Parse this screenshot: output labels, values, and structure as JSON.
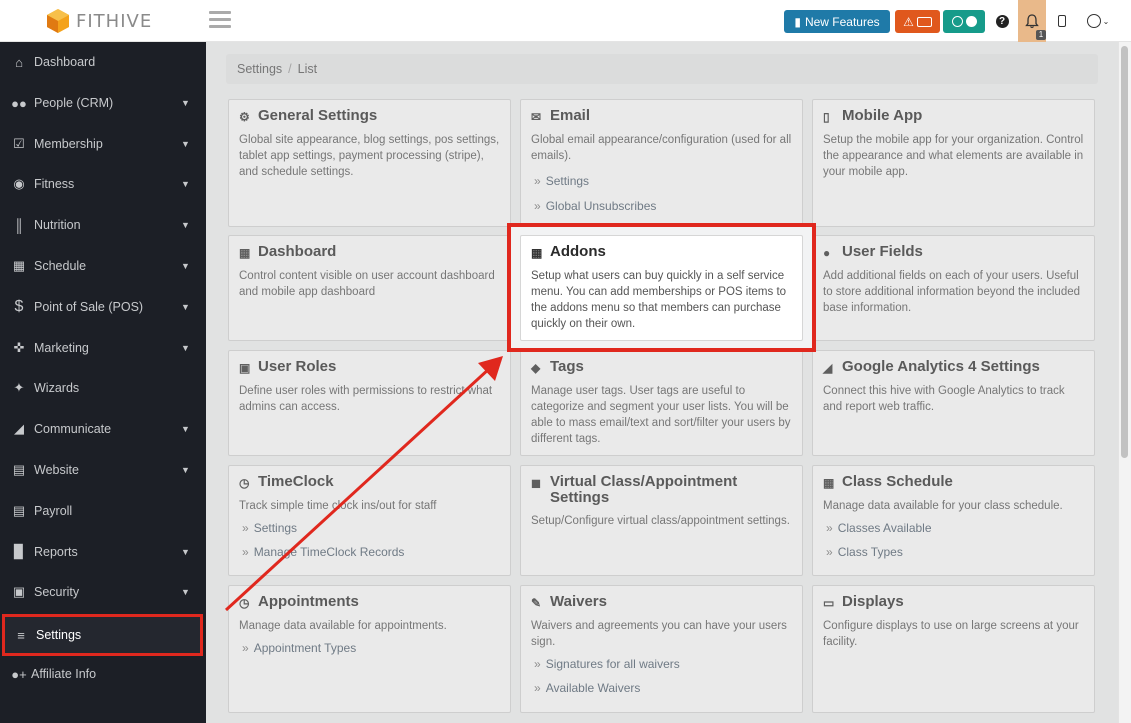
{
  "app": {
    "name": "FITHIVE"
  },
  "topbar": {
    "new_features_label": "New Features",
    "notification_count": "1",
    "colors": {
      "features": "#1f7aa8",
      "alert": "#e0581d",
      "clock": "#169b8a",
      "bell_bg": "#e9b98a"
    }
  },
  "sidebar": {
    "items": [
      {
        "label": "Dashboard",
        "icon": "home-icon",
        "chevron": false
      },
      {
        "label": "People (CRM)",
        "icon": "users-icon",
        "chevron": true
      },
      {
        "label": "Membership",
        "icon": "checkbox-icon",
        "chevron": true
      },
      {
        "label": "Fitness",
        "icon": "fitness-icon",
        "chevron": true
      },
      {
        "label": "Nutrition",
        "icon": "utensils-icon",
        "chevron": true
      },
      {
        "label": "Schedule",
        "icon": "calendar-icon",
        "chevron": true
      },
      {
        "label": "Point of Sale (POS)",
        "icon": "dollar-icon",
        "chevron": true
      },
      {
        "label": "Marketing",
        "icon": "crosshair-icon",
        "chevron": true
      },
      {
        "label": "Wizards",
        "icon": "wand-icon",
        "chevron": false
      },
      {
        "label": "Communicate",
        "icon": "megaphone-icon",
        "chevron": true
      },
      {
        "label": "Website",
        "icon": "file-icon",
        "chevron": true
      },
      {
        "label": "Payroll",
        "icon": "money-icon",
        "chevron": false
      },
      {
        "label": "Reports",
        "icon": "bar-chart-icon",
        "chevron": true
      },
      {
        "label": "Security",
        "icon": "lock-icon",
        "chevron": true
      },
      {
        "label": "Settings",
        "icon": "sliders-icon",
        "chevron": false,
        "active": true
      },
      {
        "label": "Affiliate Info",
        "icon": "user-plus-icon",
        "chevron": false
      }
    ]
  },
  "breadcrumb": {
    "items": [
      "Settings",
      "List"
    ]
  },
  "cards": {
    "general": {
      "title": "General Settings",
      "icon": "cogs-icon",
      "desc": "Global site appearance, blog settings, pos settings, tablet app settings, payment processing (stripe), and schedule settings.",
      "links": []
    },
    "email": {
      "title": "Email",
      "icon": "envelope-icon",
      "desc": "Global email appearance/configuration (used for all emails).",
      "links": [
        "Settings",
        "Global Unsubscribes"
      ]
    },
    "mobile": {
      "title": "Mobile App",
      "icon": "mobile-icon",
      "desc": "Setup the mobile app for your organization. Control the appearance and what elements are available in your mobile app.",
      "links": []
    },
    "dashboard": {
      "title": "Dashboard",
      "icon": "grid-icon",
      "desc": "Control content visible on user account dashboard and mobile app dashboard",
      "links": []
    },
    "addons": {
      "title": "Addons",
      "icon": "table-icon",
      "desc": "Setup what users can buy quickly in a self service menu. You can add memberships or POS items to the addons menu so that members can purchase quickly on their own.",
      "links": []
    },
    "userfields": {
      "title": "User Fields",
      "icon": "user-plus-icon",
      "desc": "Add additional fields on each of your users. Useful to store additional information beyond the included base information.",
      "links": []
    },
    "roles": {
      "title": "User Roles",
      "icon": "lock-icon",
      "desc": "Define user roles with permissions to restrict what admins can access.",
      "links": []
    },
    "tags": {
      "title": "Tags",
      "icon": "tags-icon",
      "desc": "Manage user tags. User tags are useful to categorize and segment your user lists. You will be able to mass email/text and sort/filter your users by different tags.",
      "links": []
    },
    "ga4": {
      "title": "Google Analytics 4 Settings",
      "icon": "area-chart-icon",
      "desc": "Connect this hive with Google Analytics to track and report web traffic.",
      "links": []
    },
    "timeclock": {
      "title": "TimeClock",
      "icon": "clock-icon",
      "desc": "Track simple time clock ins/out for staff",
      "links": [
        "Settings",
        "Manage TimeClock Records"
      ]
    },
    "virtual": {
      "title": "Virtual Class/Appointment Settings",
      "icon": "video-icon",
      "desc": "Setup/Configure virtual class/appointment settings.",
      "links": []
    },
    "classschedule": {
      "title": "Class Schedule",
      "icon": "calendar-plus-icon",
      "desc": "Manage data available for your class schedule.",
      "links": [
        "Classes Available",
        "Class Types"
      ]
    },
    "appointments": {
      "title": "Appointments",
      "icon": "clock-icon",
      "desc": "Manage data available for appointments.",
      "links": [
        "Appointment Types"
      ]
    },
    "waivers": {
      "title": "Waivers",
      "icon": "edit-icon",
      "desc": "Waivers and agreements you can have your users sign.",
      "links": [
        "Signatures for all waivers",
        "Available Waivers"
      ]
    },
    "displays": {
      "title": "Displays",
      "icon": "monitor-icon",
      "desc": "Configure displays to use on large screens at your facility.",
      "links": []
    }
  },
  "annotation": {
    "color": "#e0281e"
  }
}
